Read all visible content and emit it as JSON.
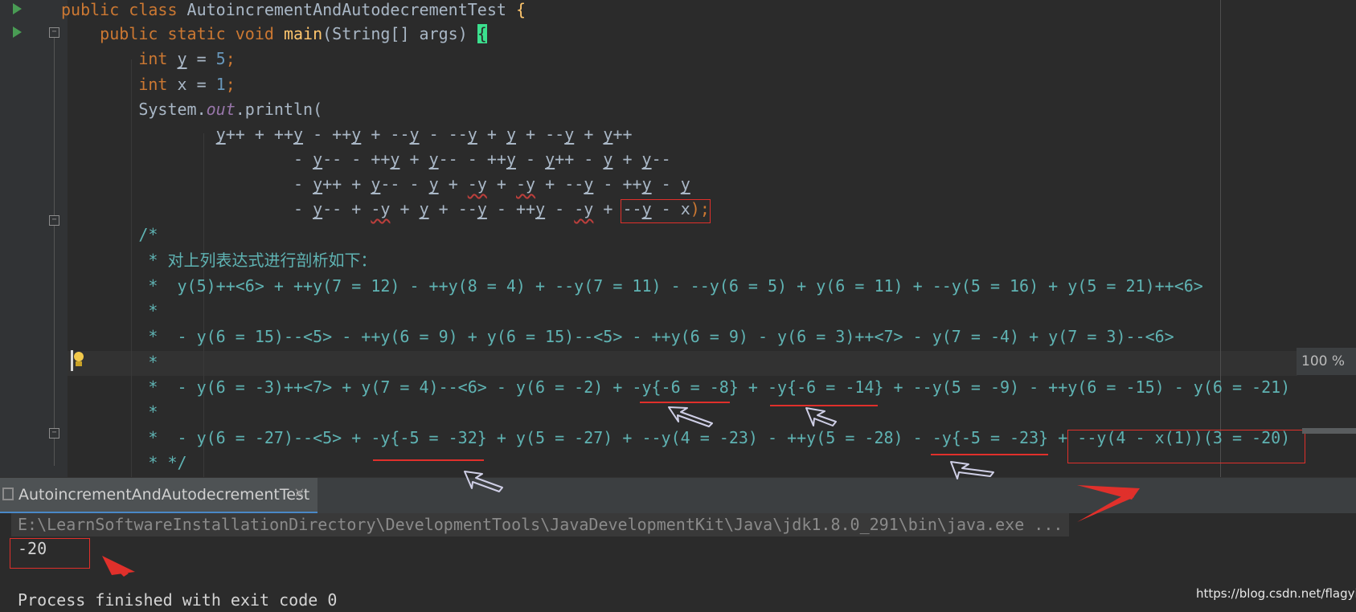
{
  "editor": {
    "lines": [
      [
        {
          "t": "public class ",
          "c": "kw"
        },
        {
          "t": "AutoincrementAndAutodecrementTest "
        },
        {
          "t": "{",
          "c": "fn"
        }
      ],
      [
        {
          "t": "    public static void ",
          "c": "kw"
        },
        {
          "t": "main",
          "c": "fn"
        },
        {
          "t": "(String[] args) "
        },
        {
          "t": "{",
          "c": "brace-hl"
        }
      ],
      [
        {
          "t": "        "
        },
        {
          "t": "int ",
          "c": "kw"
        },
        {
          "t": "y",
          "c": "ul"
        },
        {
          "t": " = "
        },
        {
          "t": "5",
          "c": "num"
        },
        {
          "t": ";",
          "c": "kw"
        }
      ],
      [
        {
          "t": "        "
        },
        {
          "t": "int ",
          "c": "kw"
        },
        {
          "t": "x = "
        },
        {
          "t": "1",
          "c": "num"
        },
        {
          "t": ";",
          "c": "kw"
        }
      ],
      [
        {
          "t": "        System."
        },
        {
          "t": "out",
          "c": "ital"
        },
        {
          "t": ".println("
        }
      ],
      [
        {
          "t": "                "
        },
        {
          "t": "y",
          "c": "ul"
        },
        {
          "t": "++ + ++"
        },
        {
          "t": "y",
          "c": "ul"
        },
        {
          "t": " - ++"
        },
        {
          "t": "y",
          "c": "ul"
        },
        {
          "t": " + --"
        },
        {
          "t": "y",
          "c": "ul"
        },
        {
          "t": " - --"
        },
        {
          "t": "y",
          "c": "ul"
        },
        {
          "t": " + "
        },
        {
          "t": "y",
          "c": "ul"
        },
        {
          "t": " + --"
        },
        {
          "t": "y",
          "c": "ul"
        },
        {
          "t": " + "
        },
        {
          "t": "y",
          "c": "ul"
        },
        {
          "t": "++"
        }
      ],
      [
        {
          "t": "                        - "
        },
        {
          "t": "y",
          "c": "ul"
        },
        {
          "t": "-- - ++"
        },
        {
          "t": "y",
          "c": "ul"
        },
        {
          "t": " + "
        },
        {
          "t": "y",
          "c": "ul"
        },
        {
          "t": "-- - ++"
        },
        {
          "t": "y",
          "c": "ul"
        },
        {
          "t": " - "
        },
        {
          "t": "y",
          "c": "ul"
        },
        {
          "t": "++ - "
        },
        {
          "t": "y",
          "c": "ul"
        },
        {
          "t": " + "
        },
        {
          "t": "y",
          "c": "ul"
        },
        {
          "t": "--"
        }
      ],
      [
        {
          "t": "                        - "
        },
        {
          "t": "y",
          "c": "ul"
        },
        {
          "t": "++ + "
        },
        {
          "t": "y",
          "c": "ul"
        },
        {
          "t": "-- - "
        },
        {
          "t": "y",
          "c": "ul"
        },
        {
          "t": " + "
        },
        {
          "t": "-y",
          "c": "ul-red"
        },
        {
          "t": " + "
        },
        {
          "t": "-y",
          "c": "ul-red"
        },
        {
          "t": " + --"
        },
        {
          "t": "y",
          "c": "ul"
        },
        {
          "t": " - ++"
        },
        {
          "t": "y",
          "c": "ul"
        },
        {
          "t": " - "
        },
        {
          "t": "y",
          "c": "ul"
        }
      ],
      [
        {
          "t": "                        - "
        },
        {
          "t": "y",
          "c": "ul"
        },
        {
          "t": "-- + "
        },
        {
          "t": "-y",
          "c": "ul-red"
        },
        {
          "t": " + "
        },
        {
          "t": "y",
          "c": "ul"
        },
        {
          "t": " + --"
        },
        {
          "t": "y",
          "c": "ul"
        },
        {
          "t": " - ++"
        },
        {
          "t": "y",
          "c": "ul"
        },
        {
          "t": " - "
        },
        {
          "t": "-y",
          "c": "ul-red"
        },
        {
          "t": " + --"
        },
        {
          "t": "y",
          "c": "ul"
        },
        {
          "t": " - x"
        },
        {
          "t": ");",
          "c": "kw"
        }
      ],
      [
        {
          "t": "        /*",
          "c": "cmt"
        }
      ],
      [
        {
          "t": "         * 对上列表达式进行剖析如下：",
          "c": "cmt"
        }
      ],
      [
        {
          "t": "         *  y(5)++<6> + ++y(7 = 12) - ++y(8 = 4) + --y(7 = 11) - --y(6 = 5) + y(6 = 11) + --y(5 = 16) + y(5 = 21)++<6>",
          "c": "cmt"
        }
      ],
      [
        {
          "t": "         *",
          "c": "cmt"
        }
      ],
      [
        {
          "t": "         *  - y(6 = 15)--<5> - ++y(6 = 9) + y(6 = 15)--<5> - ++y(6 = 9) - y(6 = 3)++<7> - y(7 = -4) + y(7 = 3)--<6>",
          "c": "cmt"
        }
      ],
      [
        {
          "t": "         *",
          "c": "cmt"
        }
      ],
      [
        {
          "t": "         *  - y(6 = -3)++<7> + y(7 = 4)--<6> - y(6 = -2) + -y{-6 = -8} + -y{-6 = -14} + --y(5 = -9) - ++y(6 = -15) - y(6 = -21)",
          "c": "cmt"
        }
      ],
      [
        {
          "t": "         *",
          "c": "cmt"
        }
      ],
      [
        {
          "t": "         *  - y(6 = -27)--<5> + -y{-5 = -32} + y(5 = -27) + --y(4 = -23) - ++y(5 = -28) - -y{-5 = -23} + --y(4 - x(1))(3 = -20)",
          "c": "cmt"
        }
      ],
      [
        {
          "t": "         * */",
          "c": "cmt"
        }
      ]
    ],
    "zoom_label": "100 %"
  },
  "run_tool": {
    "tab_label": "AutoincrementAndAutodecrementTest",
    "close_glyph": "×",
    "command_line": "E:\\LearnSoftwareInstallationDirectory\\DevelopmentTools\\JavaDevelopmentKit\\Java\\jdk1.8.0_291\\bin\\java.exe ...",
    "output_value": "-20",
    "exit_message": "Process finished with exit code 0"
  },
  "watermark": "https://blog.csdn.net/flagyili",
  "colors": {
    "background": "#2b2b2b",
    "keyword": "#cc7832",
    "function": "#ffc66d",
    "number": "#6897bb",
    "comment": "#5fb3b3",
    "annotation_red": "#e0302b",
    "run_icon": "#499c54"
  },
  "icons": [
    "run-gutter-icon",
    "fold-marker-icon",
    "lightbulb-icon",
    "close-icon",
    "console-icon"
  ]
}
